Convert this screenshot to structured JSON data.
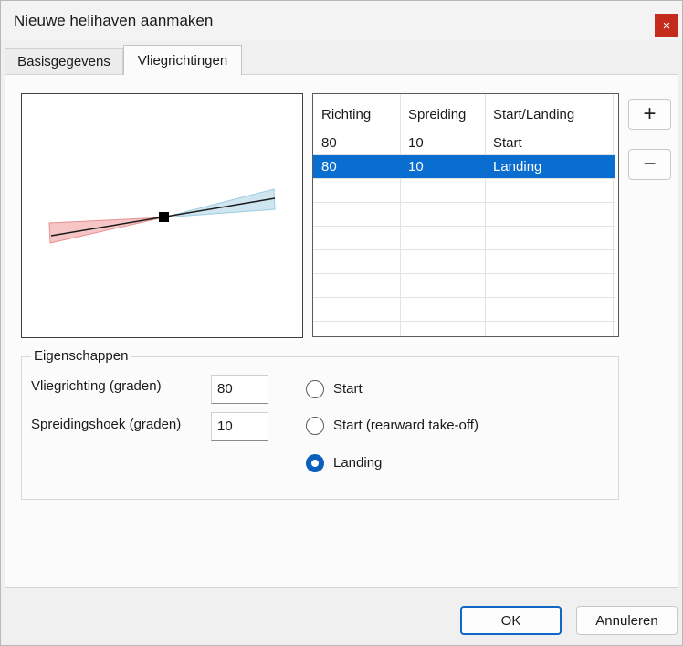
{
  "window": {
    "title": "Nieuwe helihaven aanmaken",
    "close_glyph": "×"
  },
  "tabs": [
    {
      "label": "Basisgegevens",
      "active": false
    },
    {
      "label": "Vliegrichtingen",
      "active": true
    }
  ],
  "preview": {
    "description_icons": [
      "heliport-marker-icon"
    ],
    "colors": {
      "start_sector": "#f2b7b7",
      "landing_sector": "#b9dcec",
      "line": "#1a1a1a"
    }
  },
  "table": {
    "columns": [
      "Richting",
      "Spreiding",
      "Start/Landing"
    ],
    "rows": [
      {
        "richting": "80",
        "spreiding": "10",
        "type": "Start",
        "selected": false
      },
      {
        "richting": "80",
        "spreiding": "10",
        "type": "Landing",
        "selected": true
      }
    ]
  },
  "side_buttons": {
    "add": "+",
    "remove": "−"
  },
  "properties": {
    "group_label": "Eigenschappen",
    "direction_label": "Vliegrichting (graden)",
    "direction_value": "80",
    "spread_label": "Spreidingshoek (graden)",
    "spread_value": "10",
    "radios": [
      {
        "label": "Start",
        "checked": false
      },
      {
        "label": "Start (rearward take-off)",
        "checked": false
      },
      {
        "label": "Landing",
        "checked": true
      }
    ]
  },
  "footer": {
    "ok_label": "OK",
    "cancel_label": "Annuleren"
  },
  "colors": {
    "accent": "#0a6ed1",
    "close": "#c42b1c"
  }
}
